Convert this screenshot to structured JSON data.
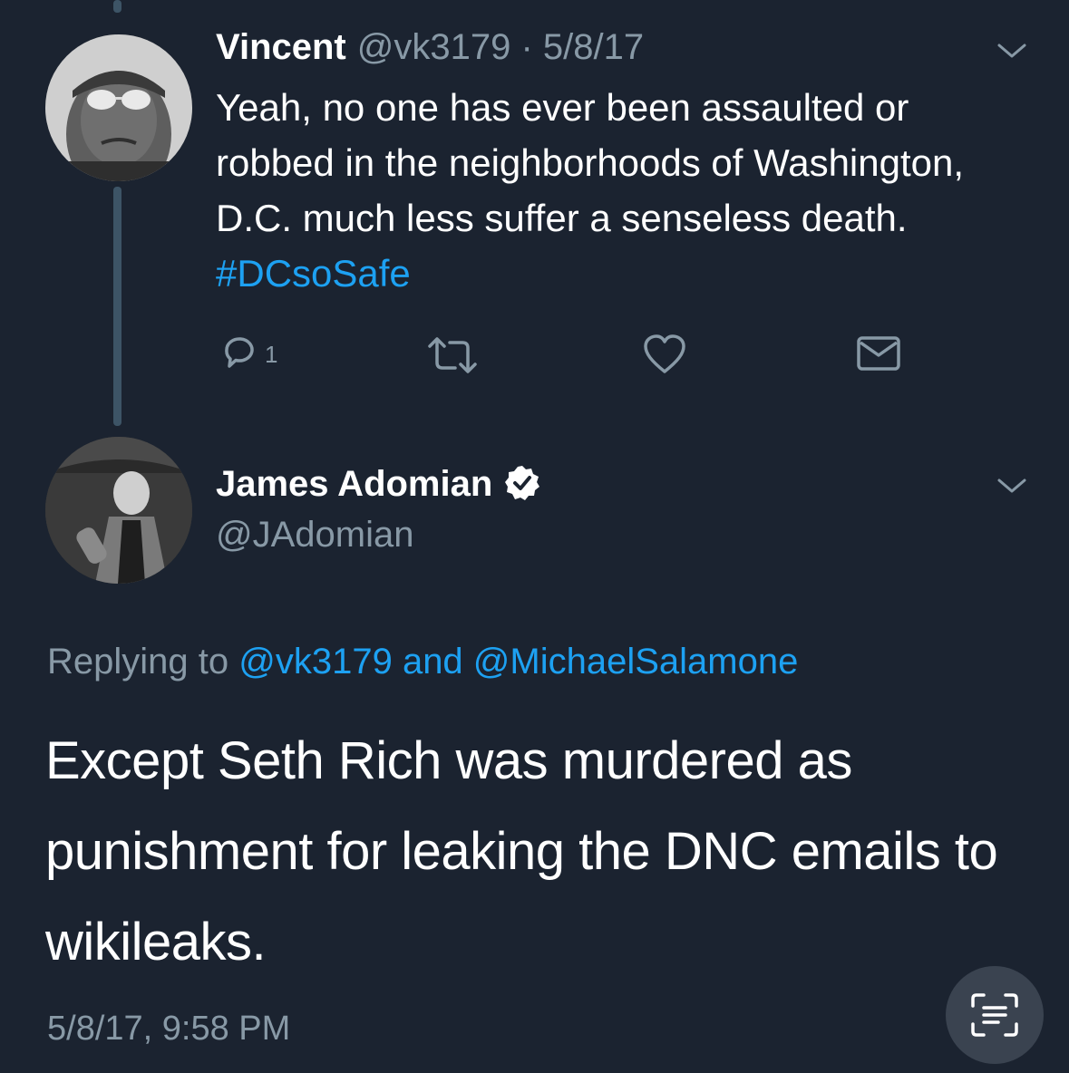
{
  "tweet1": {
    "name": "Vincent",
    "handle": "@vk3179",
    "separator": " · ",
    "date": "5/8/17",
    "text": "Yeah, no one has ever been assaulted or robbed in the neighborhoods of Washington, D.C. much less suffer a senseless death. ",
    "hashtag": "#DCsoSafe",
    "reply_count": "1",
    "icons": [
      "reply-icon",
      "retweet-icon",
      "like-icon",
      "message-icon",
      "chevron-down-icon"
    ]
  },
  "tweet2": {
    "name": "James Adomian",
    "handle": "@JAdomian",
    "verified": true,
    "replying_prefix": "Replying to ",
    "reply_to_1": "@vk3179",
    "reply_joiner": " and ",
    "reply_to_2": "@MichaelSalamone",
    "text": "Except Seth Rich was murdered as punishment for leaking the DNC emails to wikileaks.",
    "timestamp": "5/8/17, 9:58 PM"
  },
  "colors": {
    "background": "#1b2330",
    "accent": "#1da1f2",
    "muted": "#8899a6",
    "thread_line": "#3d5466"
  },
  "overlay": {
    "icon": "text-scan-icon"
  }
}
